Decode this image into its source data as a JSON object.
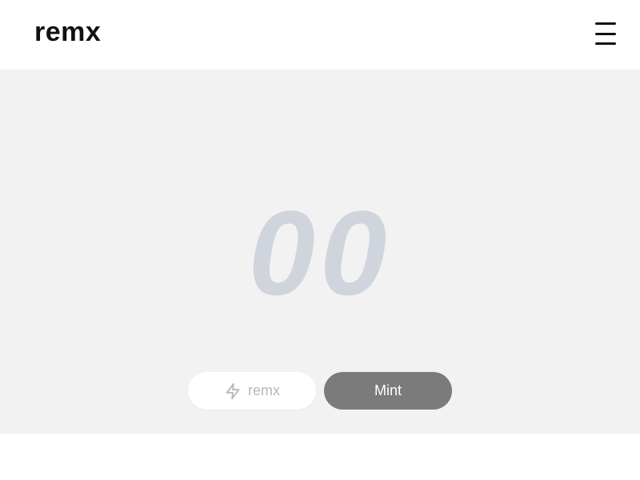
{
  "header": {
    "logo": "remx",
    "menu_icon": "hamburger-menu-icon"
  },
  "main": {
    "counter": "00",
    "counter_color": "#d0d4dc",
    "background_color": "#f2f2f2"
  },
  "actions": {
    "remx_button": {
      "label": "remx",
      "icon": "lightning-bolt-icon",
      "text_color": "#b5b7be"
    },
    "mint_button": {
      "label": "Mint",
      "background_color": "#7b7b7b"
    }
  }
}
